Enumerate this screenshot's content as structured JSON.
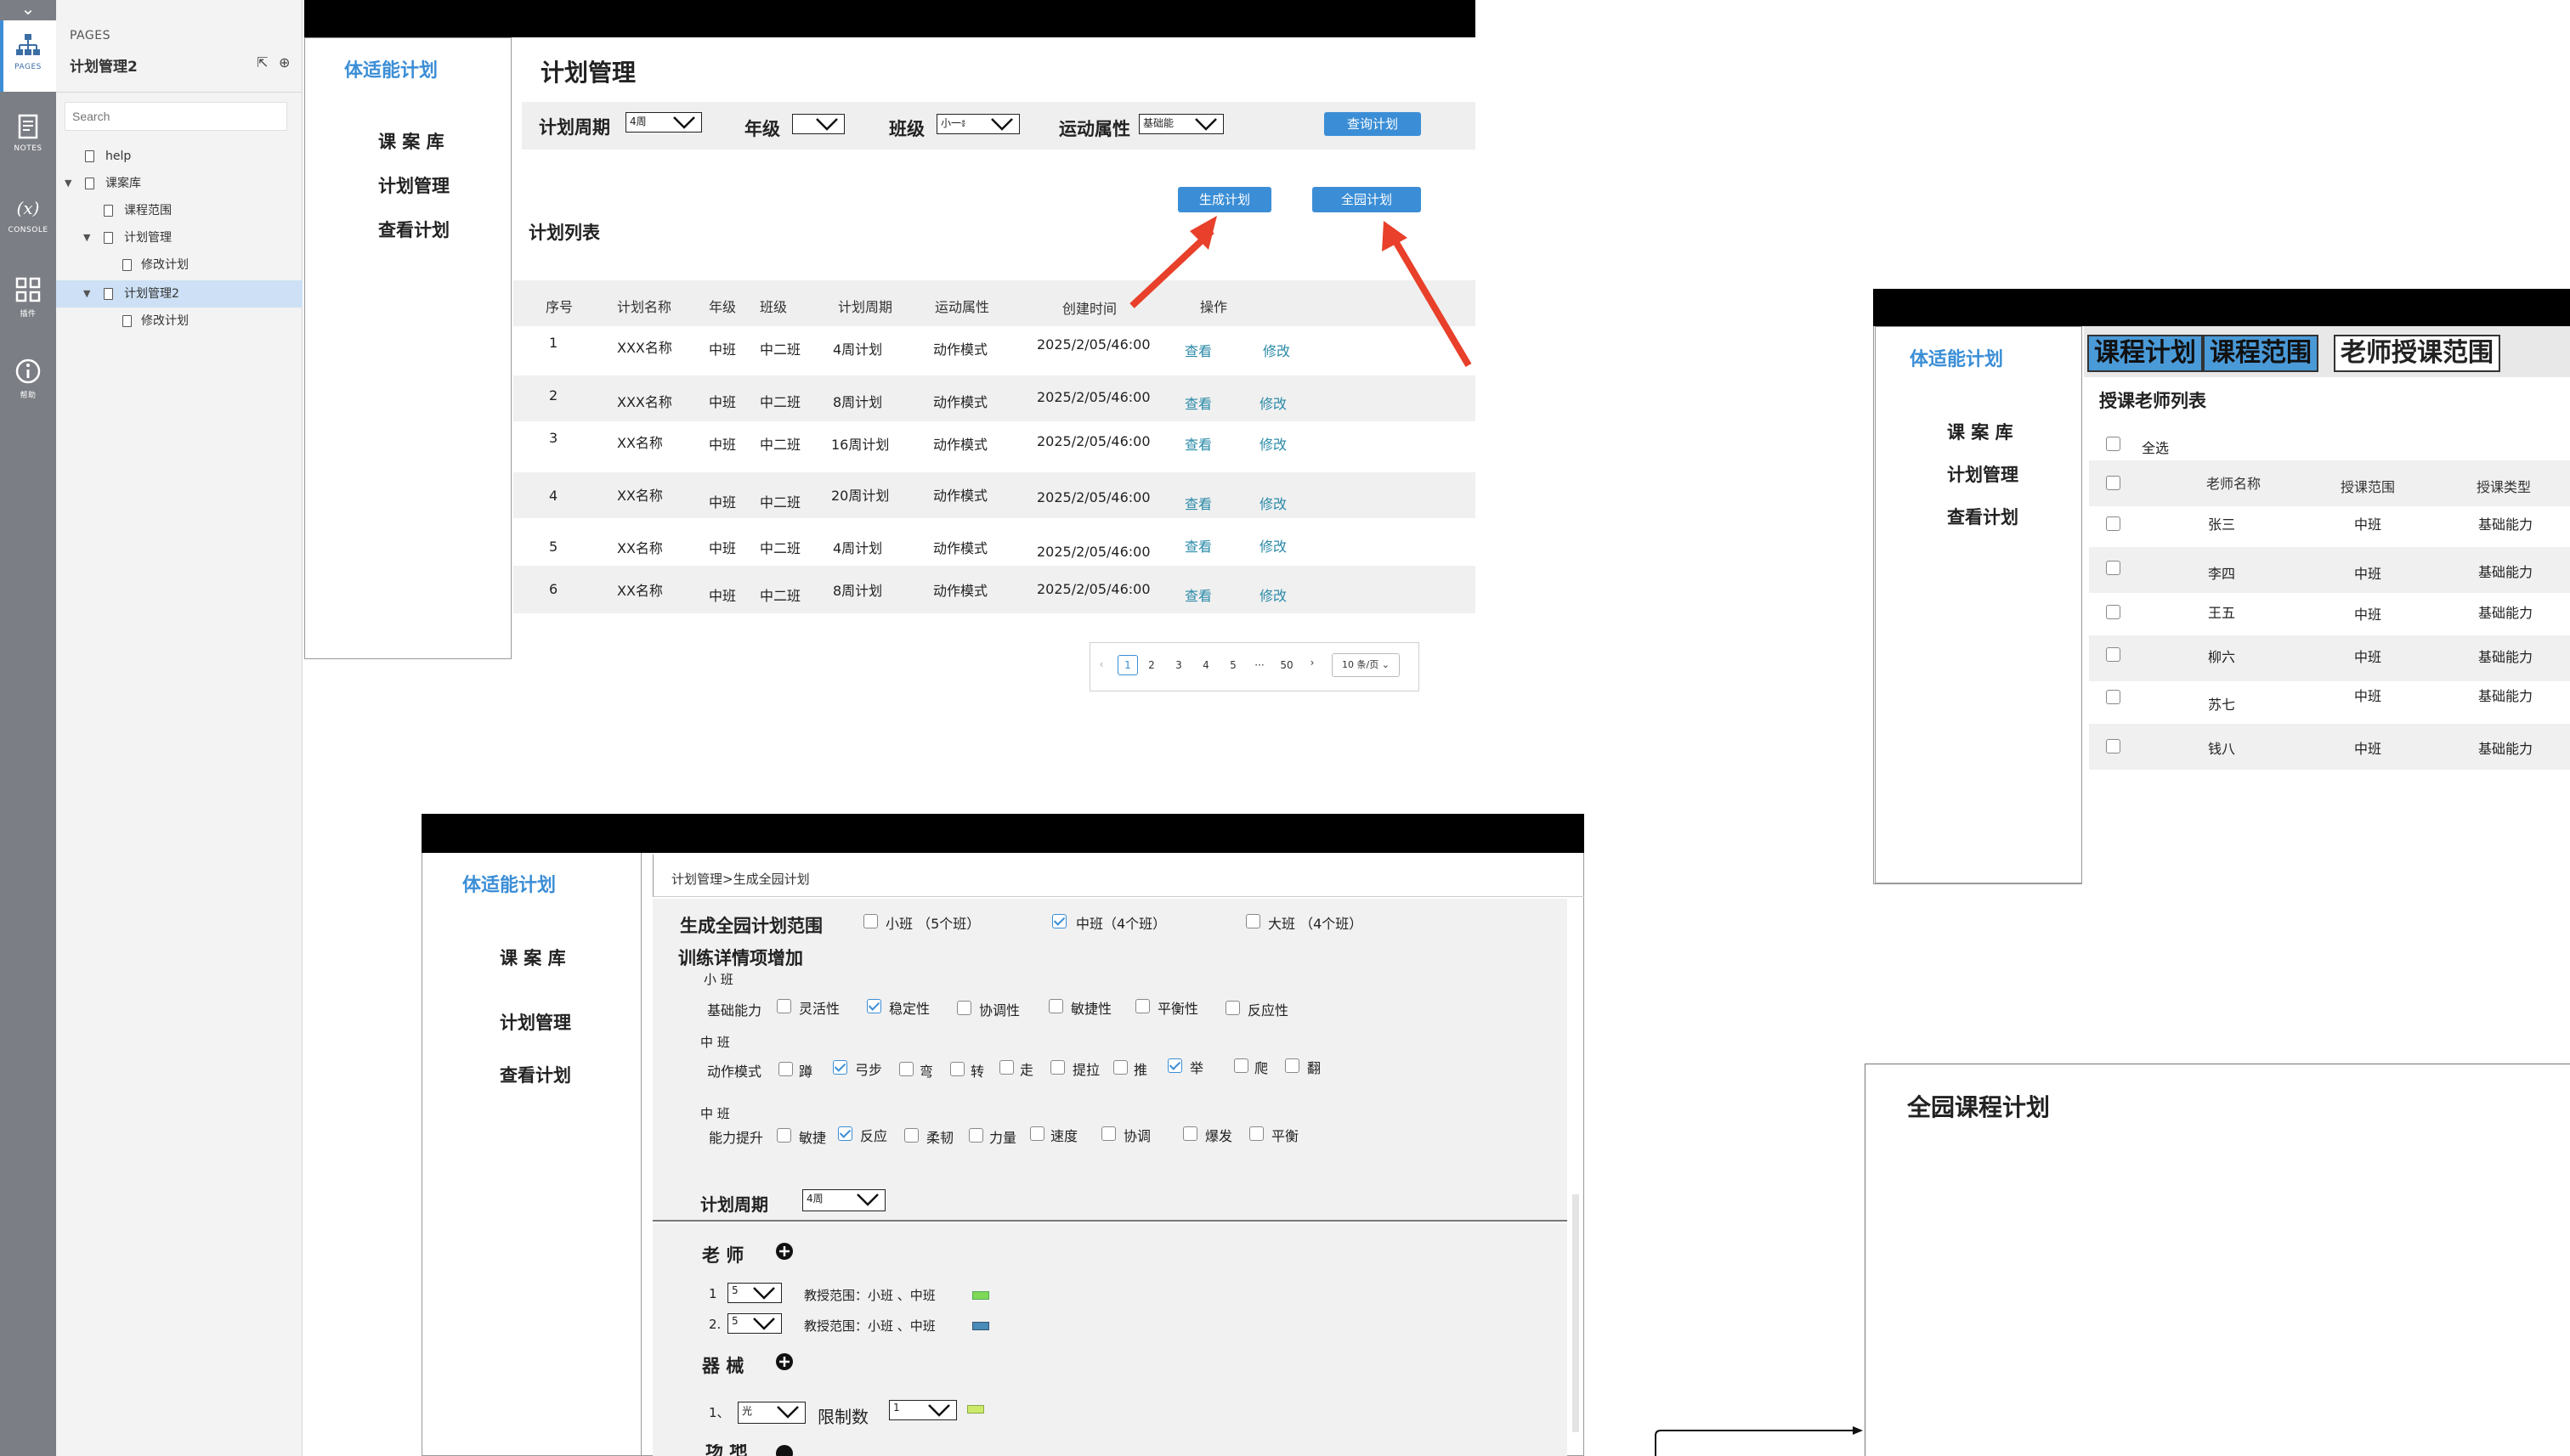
{
  "rail": {
    "items": [
      {
        "label": "PAGES"
      },
      {
        "label": "NOTES"
      },
      {
        "label": "CONSOLE"
      },
      {
        "label": "插件"
      },
      {
        "label": "帮助"
      }
    ]
  },
  "pages_panel": {
    "header": "PAGES",
    "title": "计划管理2",
    "search_placeholder": "Search",
    "tree": [
      {
        "label": "help"
      },
      {
        "label": "课案库"
      },
      {
        "label": "课程范围"
      },
      {
        "label": "计划管理"
      },
      {
        "label": "修改计划"
      },
      {
        "label": "计划管理2"
      },
      {
        "label": "修改计划"
      }
    ]
  },
  "nav": {
    "brand": "体适能计划",
    "items": [
      "课 案 库",
      "计划管理",
      "查看计划"
    ],
    "items_alt": [
      "课 案 库",
      "计划管理",
      "查看计划"
    ]
  },
  "plan_mgmt": {
    "title": "计划管理",
    "filters": {
      "period_label": "计划周期",
      "period_value": "4周",
      "grade_label": "年级",
      "grade_value": "",
      "class_label": "班级",
      "class_value": "小一៖",
      "attr_label": "运动属性",
      "attr_value": "基础能",
      "query_btn": "查询计划"
    },
    "generate_btn": "生成计划",
    "all_btn": "全园计划",
    "list_title": "计划列表",
    "columns": [
      "序号",
      "计划名称",
      "年级",
      "班级",
      "计划周期",
      "运动属性",
      "创建时间",
      "操作"
    ],
    "rows": [
      {
        "no": "1",
        "name": "XXX名称",
        "grade": "中班",
        "cls": "中二班",
        "period": "4周计划",
        "attr": "动作模式",
        "time": "2025/2/05/46:00",
        "view": "查看",
        "edit": "修改"
      },
      {
        "no": "2",
        "name": "XXX名称",
        "grade": "中班",
        "cls": "中二班",
        "period": "8周计划",
        "attr": "动作模式",
        "time": "2025/2/05/46:00",
        "view": "查看",
        "edit": "修改"
      },
      {
        "no": "3",
        "name": "XX名称",
        "grade": "中班",
        "cls": "中二班",
        "period": "16周计划",
        "attr": "动作模式",
        "time": "2025/2/05/46:00",
        "view": "查看",
        "edit": "修改"
      },
      {
        "no": "4",
        "name": "XX名称",
        "grade": "中班",
        "cls": "中二班",
        "period": "20周计划",
        "attr": "动作模式",
        "time": "2025/2/05/46:00",
        "view": "查看",
        "edit": "修改"
      },
      {
        "no": "5",
        "name": "XX名称",
        "grade": "中班",
        "cls": "中二班",
        "period": "4周计划",
        "attr": "动作模式",
        "time": "2025/2/05/46:00",
        "view": "查看",
        "edit": "修改"
      },
      {
        "no": "6",
        "name": "XX名称",
        "grade": "中班",
        "cls": "中二班",
        "period": "8周计划",
        "attr": "动作模式",
        "time": "2025/2/05/46:00",
        "view": "查看",
        "edit": "修改"
      }
    ],
    "pager": {
      "prev": "‹",
      "pages": [
        "1",
        "2",
        "3",
        "4",
        "5",
        "···",
        "50"
      ],
      "next": "›",
      "size": "10 条/页"
    }
  },
  "teacher_panel": {
    "tabs": [
      "课程计划",
      "课程范围",
      "老师授课范围"
    ],
    "list_title": "授课老师列表",
    "select_all": "全选",
    "columns": [
      "老师名称",
      "授课范围",
      "授课类型"
    ],
    "rows": [
      {
        "name": "张三",
        "range": "中班",
        "type": "基础能力"
      },
      {
        "name": "李四",
        "range": "中班",
        "type": "基础能力"
      },
      {
        "name": "王五",
        "range": "中班",
        "type": "基础能力"
      },
      {
        "name": "柳六",
        "range": "中班",
        "type": "基础能力"
      },
      {
        "name": "苏七",
        "range": "中班",
        "type": "基础能力"
      },
      {
        "name": "钱八",
        "range": "中班",
        "type": "基础能力"
      }
    ]
  },
  "generate_panel": {
    "breadcrumb": "计划管理>生成全园计划",
    "scope_label": "生成全园计划范围",
    "scope_options": [
      {
        "label": "小班  （5个班）",
        "checked": false
      },
      {
        "label": "中班（4个班）",
        "checked": true
      },
      {
        "label": "大班  （4个班）",
        "checked": false
      }
    ],
    "detail_title": "训练详情项增加",
    "group1_title": "小    班",
    "group1_label": "基础能力",
    "group1_options": [
      {
        "label": "灵活性",
        "checked": false
      },
      {
        "label": "稳定性",
        "checked": true
      },
      {
        "label": "协调性",
        "checked": false
      },
      {
        "label": "敏捷性",
        "checked": false
      },
      {
        "label": "平衡性",
        "checked": false
      },
      {
        "label": "反应性",
        "checked": false
      }
    ],
    "group2_title": "中    班",
    "group2_label": "动作模式",
    "group2_options": [
      {
        "label": "蹲",
        "checked": false
      },
      {
        "label": "弓步",
        "checked": true
      },
      {
        "label": "弯",
        "checked": false
      },
      {
        "label": "转",
        "checked": false
      },
      {
        "label": "走",
        "checked": false
      },
      {
        "label": "提拉",
        "checked": false
      },
      {
        "label": "推",
        "checked": false
      },
      {
        "label": "举",
        "checked": true
      },
      {
        "label": "爬",
        "checked": false
      },
      {
        "label": "翻",
        "checked": false
      }
    ],
    "group3_title": "中    班",
    "group3_label": "能力提升",
    "group3_options": [
      {
        "label": "敏捷",
        "checked": false
      },
      {
        "label": "反应",
        "checked": true
      },
      {
        "label": "柔韧",
        "checked": false
      },
      {
        "label": "力量",
        "checked": false
      },
      {
        "label": "速度",
        "checked": false
      },
      {
        "label": "协调",
        "checked": false
      },
      {
        "label": "爆发",
        "checked": false
      },
      {
        "label": "平衡",
        "checked": false
      }
    ],
    "period_label": "计划周期",
    "period_value": "4周",
    "teacher_title": "老    师",
    "teachers": [
      {
        "idx": "1",
        "sel": "5",
        "range": "教授范围：小班  、中班"
      },
      {
        "idx": "2.",
        "sel": "5",
        "range": "教授范围：小班  、中班"
      }
    ],
    "equip_title": "器    械",
    "equip_idx": "1、",
    "equip_sel": "光",
    "equip_limit_label": "限制数",
    "equip_limit_value": "1",
    "site_title": "场    地"
  },
  "national_panel": {
    "title": "全园课程计划"
  },
  "colors": {
    "accent": "#3b8ed6",
    "arrow": "#e8402a",
    "green_swatch": "#7ed957",
    "blue_swatch": "#4a8bb8"
  }
}
